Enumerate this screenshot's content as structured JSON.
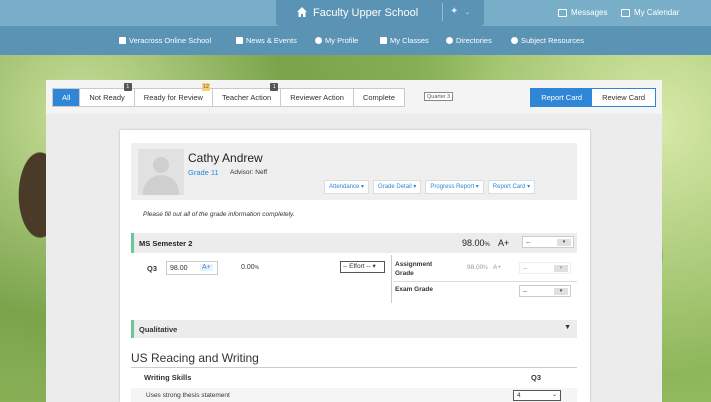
{
  "colors": {
    "topbar": "#79aec8",
    "subnav": "#5a93b3",
    "accent": "#2f86d6",
    "section_marker": "#6cc69b"
  },
  "header": {
    "school_title": "Faculty Upper School",
    "messages": "Messages",
    "calendar": "My Calendar"
  },
  "subnav": {
    "items": [
      {
        "label": "Veracross Online School",
        "icon": "graduation-cap-icon"
      },
      {
        "label": "News & Events",
        "icon": "bookmark-icon"
      },
      {
        "label": "My Profile",
        "icon": "user-icon"
      },
      {
        "label": "My Classes",
        "icon": "calendar-icon"
      },
      {
        "label": "Directories",
        "icon": "phone-icon"
      },
      {
        "label": "Subject Resources",
        "icon": "cloud-icon"
      }
    ]
  },
  "toolbar": {
    "tabs": [
      {
        "label": "All",
        "active": true
      },
      {
        "label": "Not Ready",
        "badge": "1"
      },
      {
        "label": "Ready for Review",
        "badge": "12"
      },
      {
        "label": "Teacher Action",
        "badge": "1"
      },
      {
        "label": "Reviewer Action"
      },
      {
        "label": "Complete"
      }
    ],
    "quarter": "Quarter 3",
    "report_card": "Report Card",
    "review_card": "Review Card"
  },
  "student": {
    "name": "Cathy Andrew",
    "grade": "Grade 11",
    "advisor": "Advisor: Neff",
    "buttons": [
      "Attendance",
      "Grade Detail",
      "Progress Report",
      "Report Card"
    ]
  },
  "notice": "Please fill out all of the grade information completely.",
  "semester": {
    "label": "MS Semester 2",
    "score": "98.00",
    "score_unit": "%",
    "letter": "A+",
    "select_value": "--"
  },
  "q3": {
    "label": "Q3",
    "value": "98.00",
    "letter": "A+",
    "percent": "0.00",
    "percent_unit": "%",
    "effort": "-- Effort --",
    "assignment_label": "Assignment Grade",
    "assignment_value": "98.00",
    "assignment_unit": "%",
    "assignment_letter": "A+",
    "assignment_select": "--",
    "exam_label": "Exam Grade",
    "exam_select": "--"
  },
  "qualitative": {
    "label": "Qualitative"
  },
  "section": {
    "title": "US Reacing and Writing"
  },
  "skills": {
    "label": "Writing Skills",
    "col": "Q3"
  },
  "thesis": {
    "label": "Uses strong thesis statement",
    "value": "4"
  }
}
